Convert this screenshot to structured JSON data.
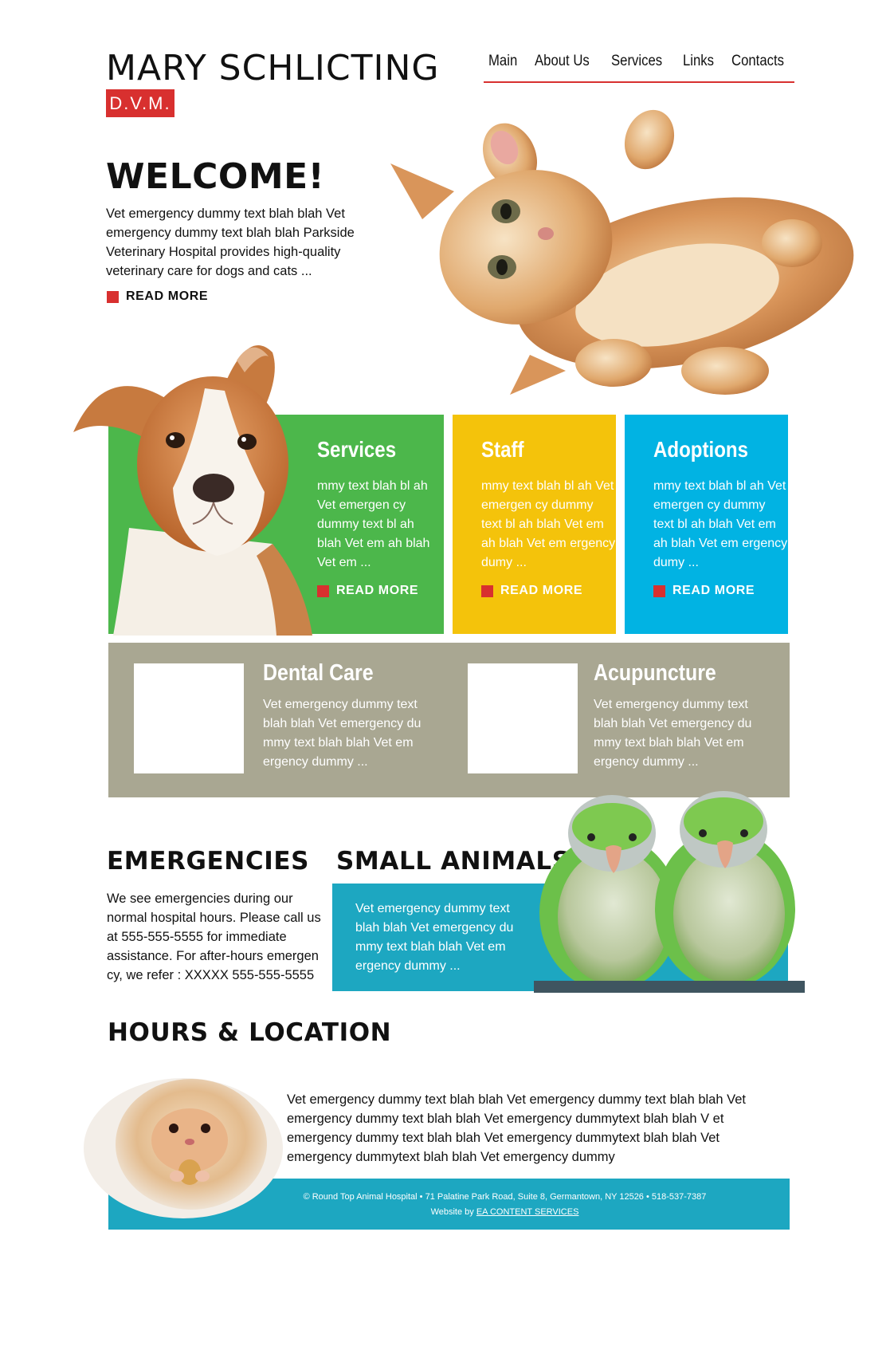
{
  "header": {
    "title": "MARY SCHLICTING",
    "badge": "D.V.M."
  },
  "nav": {
    "items": [
      "Main",
      "About Us",
      "Services",
      "Links",
      "Contacts"
    ]
  },
  "welcome": {
    "title": "WELCOME!",
    "text": "Vet emergency dummy text blah blah Vet emergency dummy text blah blah Parkside Veterinary Hospital provides high-quality veterinary care for dogs and cats ...",
    "read_more": "READ MORE"
  },
  "boxes": {
    "services": {
      "title": "Services",
      "text": "mmy text blah bl ah Vet emergen cy dummy text bl ah blah Vet em ah blah Vet em ...",
      "read_more": "READ MORE",
      "color": "#4cb74b"
    },
    "staff": {
      "title": "Staff",
      "text": "mmy text blah bl ah Vet emergen cy dummy text bl ah blah Vet em ah blah Vet em ergency dumy ...",
      "read_more": "READ MORE",
      "color": "#f4c30b"
    },
    "adoptions": {
      "title": "Adoptions",
      "text": "mmy text blah bl ah Vet emergen cy dummy text bl ah blah Vet em ah blah Vet em ergency dumy ...",
      "read_more": "READ MORE",
      "color": "#01b3e3"
    }
  },
  "features": {
    "dental": {
      "title": "Dental Care",
      "text": "Vet emergency dummy text blah blah Vet emergency du mmy text blah blah Vet em ergency dummy ..."
    },
    "acupuncture": {
      "title": "Acupuncture",
      "text": "Vet emergency dummy text blah blah Vet emergency du mmy text blah blah Vet em ergency dummy ..."
    }
  },
  "emergencies": {
    "title": "EMERGENCIES",
    "text": "We see emergencies during our normal hospital hours. Please call us at 555-555-5555 for immediate assistance. For after-hours emergen cy, we refer : XXXXX 555-555-5555"
  },
  "small_animals": {
    "title": "SMALL ANIMALS",
    "text": "Vet emergency dummy text blah blah Vet emergency du mmy text blah blah Vet em ergency dummy ..."
  },
  "hours": {
    "title": "HOURS & LOCATION",
    "text": "Vet emergency dummy text blah blah Vet emergency dummy text blah blah Vet emergency dummy text blah blah Vet emergency dummytext blah blah V et emergency dummy text blah blah Vet emergency dummytext blah blah Vet emergency dummytext blah blah Vet emergency dummy"
  },
  "footer": {
    "line1": "© Round Top Animal Hospital •  71 Palatine Park Road, Suite 8, Germantown, NY 12526  • 518-537-7387",
    "credit_prefix": "Website by ",
    "credit_link": "EA CONTENT SERVICES"
  },
  "icons": [
    "kitten-image",
    "puppy-image",
    "parrots-image",
    "hamster-image"
  ]
}
